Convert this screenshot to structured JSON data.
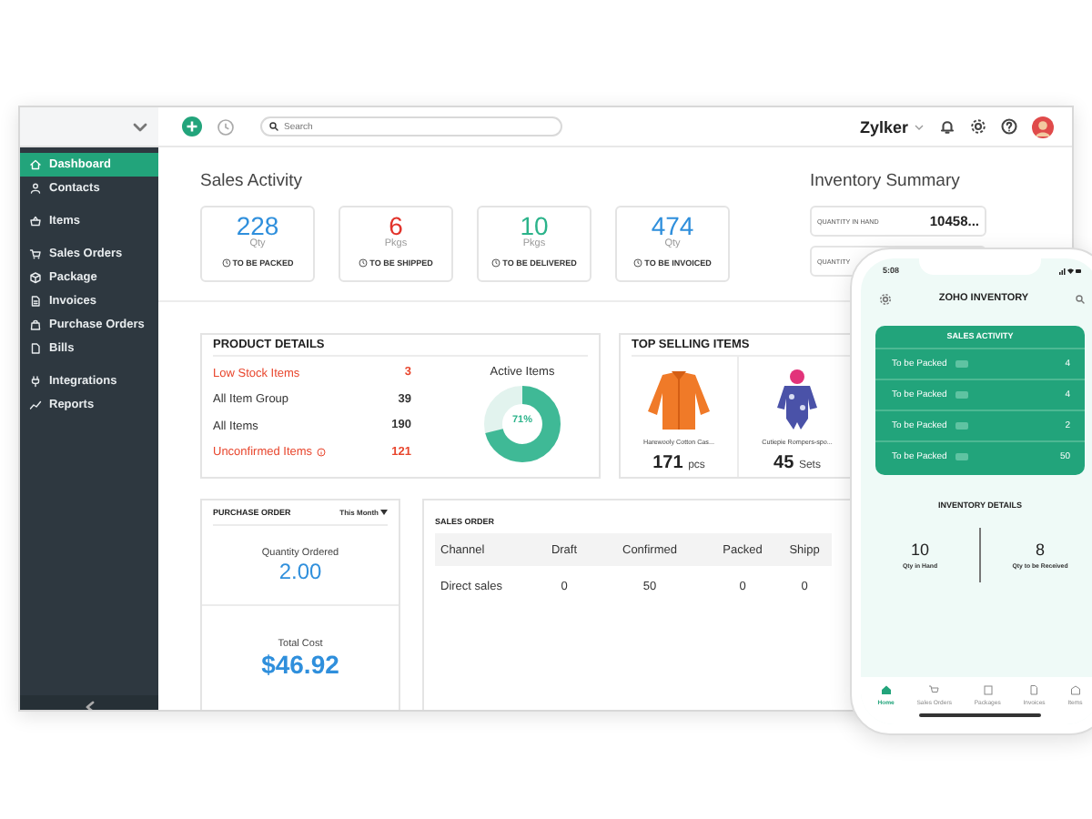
{
  "sidebar": {
    "groups": [
      {
        "items": [
          {
            "label": "Dashboard",
            "selected": true
          },
          {
            "label": "Contacts",
            "selected": false
          }
        ]
      },
      {
        "items": [
          {
            "label": "Items",
            "selected": false
          }
        ]
      },
      {
        "items": [
          {
            "label": "Sales Orders",
            "selected": false
          },
          {
            "label": "Package",
            "selected": false
          },
          {
            "label": "Invoices",
            "selected": false
          },
          {
            "label": "Purchase Orders",
            "selected": false
          },
          {
            "label": "Bills",
            "selected": false
          }
        ]
      },
      {
        "items": [
          {
            "label": "Integrations",
            "selected": false
          },
          {
            "label": "Reports",
            "selected": false
          }
        ]
      }
    ]
  },
  "topbar": {
    "search": {
      "placeholder": "Search"
    },
    "organization": "Zylker"
  },
  "sales_activity": {
    "title": "Sales Activity",
    "cards": [
      {
        "value": "228",
        "unit": "Qty",
        "label": "TO BE PACKED",
        "color": "#2f8fdc"
      },
      {
        "value": "6",
        "unit": "Pkgs",
        "label": "TO BE SHIPPED",
        "color": "#e2332b"
      },
      {
        "value": "10",
        "unit": "Pkgs",
        "label": "TO BE DELIVERED",
        "color": "#2bb38a"
      },
      {
        "value": "474",
        "unit": "Qty",
        "label": "TO BE INVOICED",
        "color": "#2f8fdc"
      }
    ]
  },
  "inventory_summary": {
    "title": "Inventory Summary",
    "rows": [
      {
        "label": "QUANTITY IN HAND",
        "value": "10458..."
      },
      {
        "label": "QUANTITY"
      }
    ]
  },
  "product_details": {
    "title": "PRODUCT DETAILS",
    "rows": [
      {
        "label": "Low Stock Items",
        "value": "3",
        "alert": true,
        "info": false
      },
      {
        "label": "All Item Group",
        "value": "39",
        "alert": false,
        "info": false
      },
      {
        "label": "All Items",
        "value": "190",
        "alert": false,
        "info": false
      },
      {
        "label": "Unconfirmed Items",
        "value": "121",
        "alert": true,
        "info": true
      }
    ],
    "active_items": {
      "title": "Active Items",
      "level": 0.71,
      "reading": "71%"
    }
  },
  "top_selling": {
    "title": "TOP SELLING ITEMS",
    "items": [
      {
        "name": "Harewooly Cotton Cas...",
        "quantity": "171",
        "unit": "pcs",
        "kind": "picture"
      },
      {
        "name": "Cutiepie Rompers-spo...",
        "quantity": "45",
        "unit": "Sets",
        "kind": "picture"
      }
    ]
  },
  "purchase_order": {
    "title": "PURCHASE ORDER",
    "period": "This Month",
    "quantity_label": "Quantity Ordered",
    "quantity": "2.00",
    "cost_label": "Total Cost",
    "cost": "$46.92"
  },
  "sales_order": {
    "title": "SALES ORDER",
    "columns": [
      "Channel",
      "Draft",
      "Confirmed",
      "Packed",
      "Shipp"
    ],
    "rows": [
      [
        "Direct sales",
        "0",
        "50",
        "0",
        "0"
      ]
    ]
  },
  "phone": {
    "time": "5:08",
    "title": "ZOHO INVENTORY",
    "sales_activity": {
      "title": "SALES ACTIVITY",
      "rows": [
        {
          "label": "To be Packed",
          "value": "4"
        },
        {
          "label": "To be Packed",
          "value": "4"
        },
        {
          "label": "To be Packed",
          "value": "2"
        },
        {
          "label": "To be Packed",
          "value": "50"
        }
      ]
    },
    "inventory_details": {
      "title": "INVENTORY DETAILS",
      "stats": [
        {
          "value": "10",
          "label": "Qty in Hand"
        },
        {
          "value": "8",
          "label": "Qty to be Received"
        }
      ]
    },
    "nav": [
      {
        "label": "Home",
        "selected": true
      },
      {
        "label": "Sales Orders",
        "selected": false
      },
      {
        "label": "Packages",
        "selected": false
      },
      {
        "label": "Invoices",
        "selected": false
      },
      {
        "label": "Items",
        "selected": false
      }
    ]
  }
}
